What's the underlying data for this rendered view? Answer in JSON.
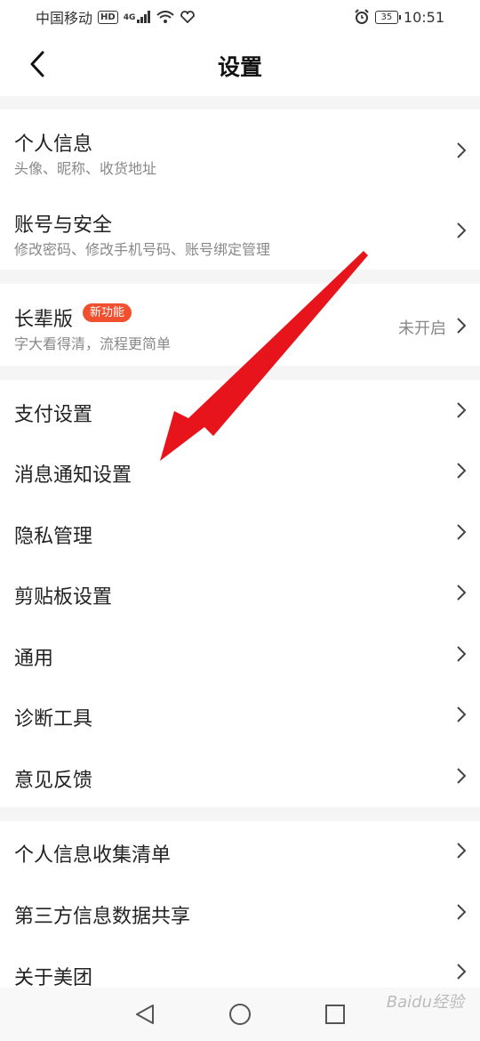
{
  "status_bar": {
    "carrier": "中国移动",
    "hd": "HD",
    "network": "4G",
    "battery": "35",
    "time": "10:51"
  },
  "header": {
    "title": "设置",
    "back_icon": "chevron-left-icon"
  },
  "sections": [
    {
      "items": [
        {
          "title": "个人信息",
          "subtitle": "头像、昵称、收货地址"
        },
        {
          "title": "账号与安全",
          "subtitle": "修改密码、修改手机号码、账号绑定管理"
        }
      ]
    },
    {
      "items": [
        {
          "title": "长辈版",
          "badge": "新功能",
          "subtitle": "字大看得清，流程更简单",
          "value": "未开启"
        }
      ]
    },
    {
      "items": [
        {
          "title": "支付设置"
        },
        {
          "title": "消息通知设置"
        },
        {
          "title": "隐私管理"
        },
        {
          "title": "剪贴板设置"
        },
        {
          "title": "通用"
        },
        {
          "title": "诊断工具"
        },
        {
          "title": "意见反馈"
        }
      ]
    },
    {
      "items": [
        {
          "title": "个人信息收集清单"
        },
        {
          "title": "第三方信息数据共享"
        },
        {
          "title": "关于美团"
        }
      ]
    }
  ],
  "system_nav": {
    "back": "triangle-back-icon",
    "home": "circle-home-icon",
    "recents": "square-recents-icon"
  },
  "watermark": "Baidu经验",
  "colors": {
    "accent": "#f0502e",
    "arrow": "#e8141b"
  }
}
